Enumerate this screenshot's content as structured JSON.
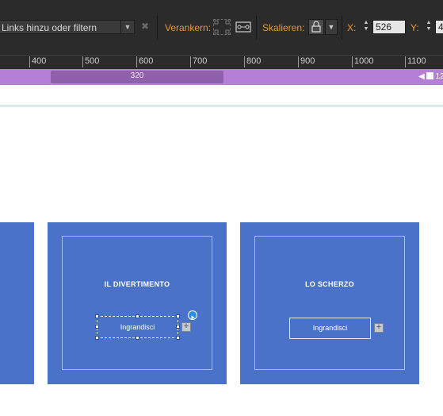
{
  "toolbar": {
    "link_filter_placeholder": "Links hinzu oder filtern",
    "anchor_label": "Verankern:",
    "scale_label": "Skalieren:",
    "x_label": "X:",
    "x_value": "526",
    "y_label": "Y:",
    "y_value": "4",
    "icons": [
      "dropdown-arrow-icon",
      "clear-x-icon",
      "anchor-grid-icon",
      "anchor-link-icon",
      "scale-lock-icon",
      "spin-arrows-icon"
    ],
    "accent_color": "#e59a32"
  },
  "ruler": {
    "ticks": [
      "400",
      "500",
      "600",
      "700",
      "800",
      "900",
      "1000",
      "1100"
    ]
  },
  "breakpoints": {
    "active_label": "320",
    "marker_label": "12",
    "bar_color": "#b57fd6"
  },
  "cards": [
    {
      "title": "IL DIVERTIMENTO",
      "button_label": "Ingrandisci"
    },
    {
      "title": "LO SCHERZO",
      "button_label": "Ingrandisci"
    }
  ],
  "colors": {
    "card_blue": "#4a72c9"
  }
}
